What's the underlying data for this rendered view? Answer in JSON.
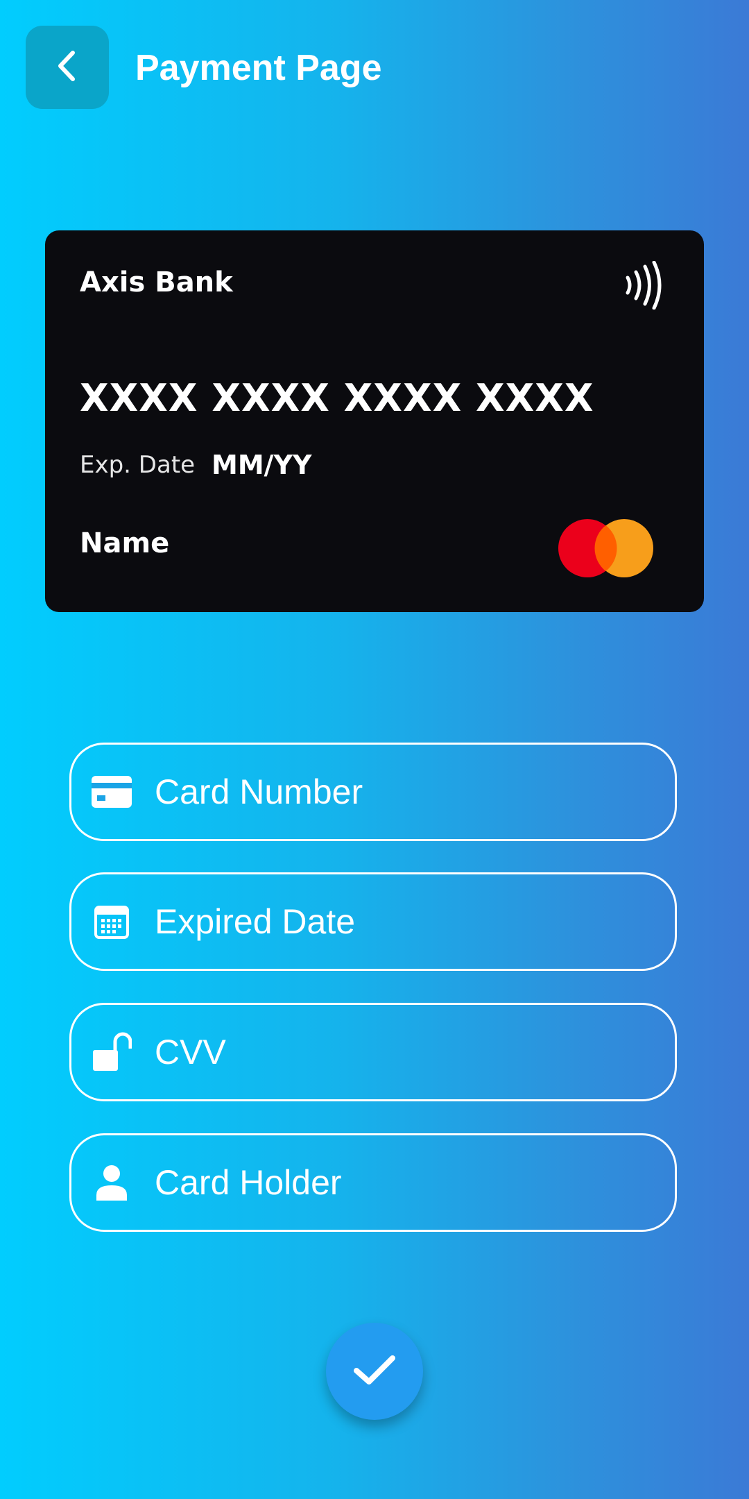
{
  "header": {
    "title": "Payment Page",
    "back_icon": "chevron-left-icon"
  },
  "card": {
    "bank": "Axis Bank",
    "number": "XXXX XXXX XXXX XXXX",
    "exp_label": "Exp. Date",
    "exp_value": "MM/YY",
    "name": "Name",
    "contactless_icon": "nfc-icon",
    "brand_logo": "mastercard-logo",
    "background": "#0b0b0f"
  },
  "form": {
    "card_number": {
      "placeholder": "Card Number",
      "value": "",
      "icon": "credit-card-icon"
    },
    "expiry": {
      "placeholder": "Expired Date",
      "value": "",
      "icon": "calendar-icon"
    },
    "cvv": {
      "placeholder": "CVV",
      "value": "",
      "icon": "unlock-icon"
    },
    "holder": {
      "placeholder": "Card Holder",
      "value": "",
      "icon": "person-icon"
    }
  },
  "submit": {
    "icon": "check-icon",
    "color": "#239cf0"
  },
  "colors": {
    "gradient_start": "#01cdfe",
    "gradient_end": "#3b7ad6",
    "text": "#ffffff"
  }
}
